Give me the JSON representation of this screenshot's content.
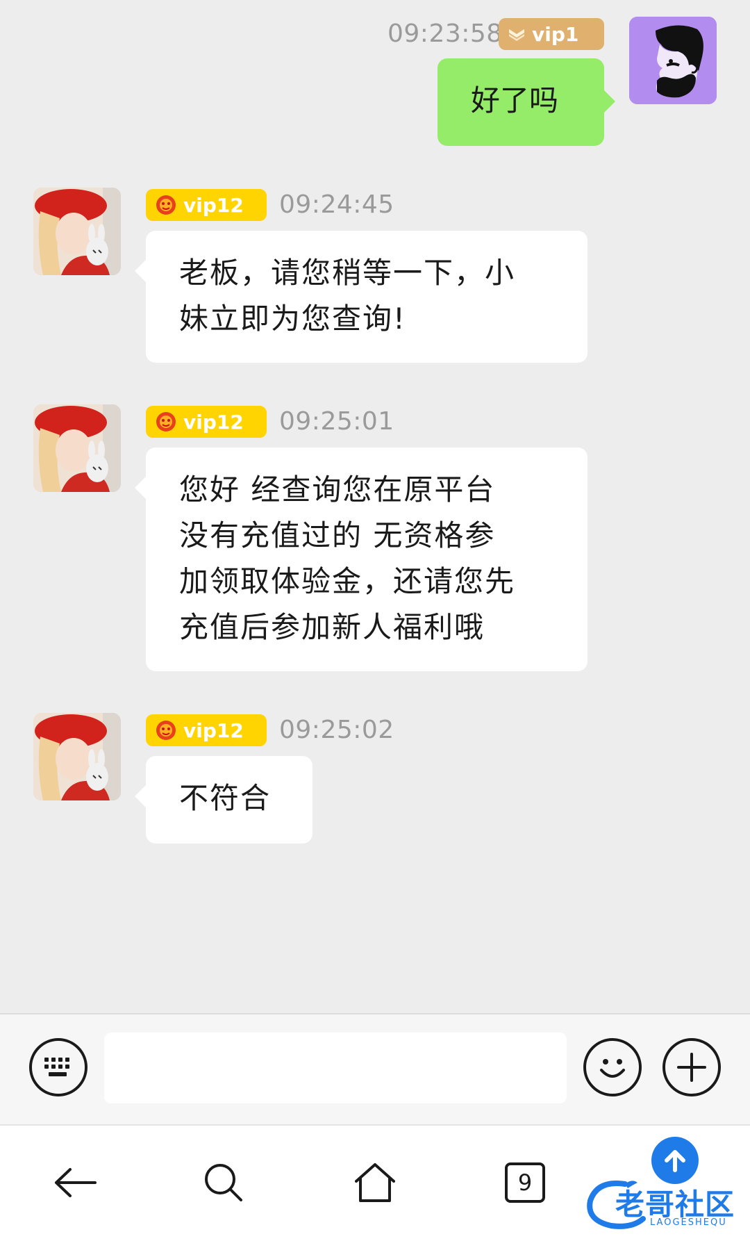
{
  "messages": [
    {
      "side": "right",
      "time": "09:23:58",
      "badge": "vip1",
      "text": "好了吗"
    },
    {
      "side": "left",
      "time": "09:24:45",
      "badge": "vip12",
      "lines": [
        "老板，请您稍等一下，小",
        "妹立即为您查询!"
      ]
    },
    {
      "side": "left",
      "time": "09:25:01",
      "badge": "vip12",
      "lines": [
        "您好 经查询您在原平台",
        "没有充值过的 无资格参",
        "加领取体验金，还请您先",
        "充值后参加新人福利哦"
      ]
    },
    {
      "side": "left",
      "time": "09:25:02",
      "badge": "vip12",
      "text": "不符合"
    }
  ],
  "input": {
    "placeholder": "",
    "value": ""
  },
  "nav": {
    "tab_count": "9"
  },
  "watermark": {
    "main": "老哥社区",
    "sub": "LAOGESHEQU"
  },
  "icons": {
    "keyboard": "keyboard-icon",
    "emoji": "emoji-icon",
    "plus": "plus-icon",
    "back": "back-arrow-icon",
    "search": "search-icon",
    "home": "home-icon",
    "tabs": "tabs-icon"
  },
  "colors": {
    "background": "#ededed",
    "bubble_self": "#95ec69",
    "bubble_other": "#ffffff",
    "badge_vip1": "#e0b16e",
    "badge_vip12": "#ffd400",
    "timestamp": "#9a9a9a",
    "watermark_blue": "#1e7be8"
  }
}
